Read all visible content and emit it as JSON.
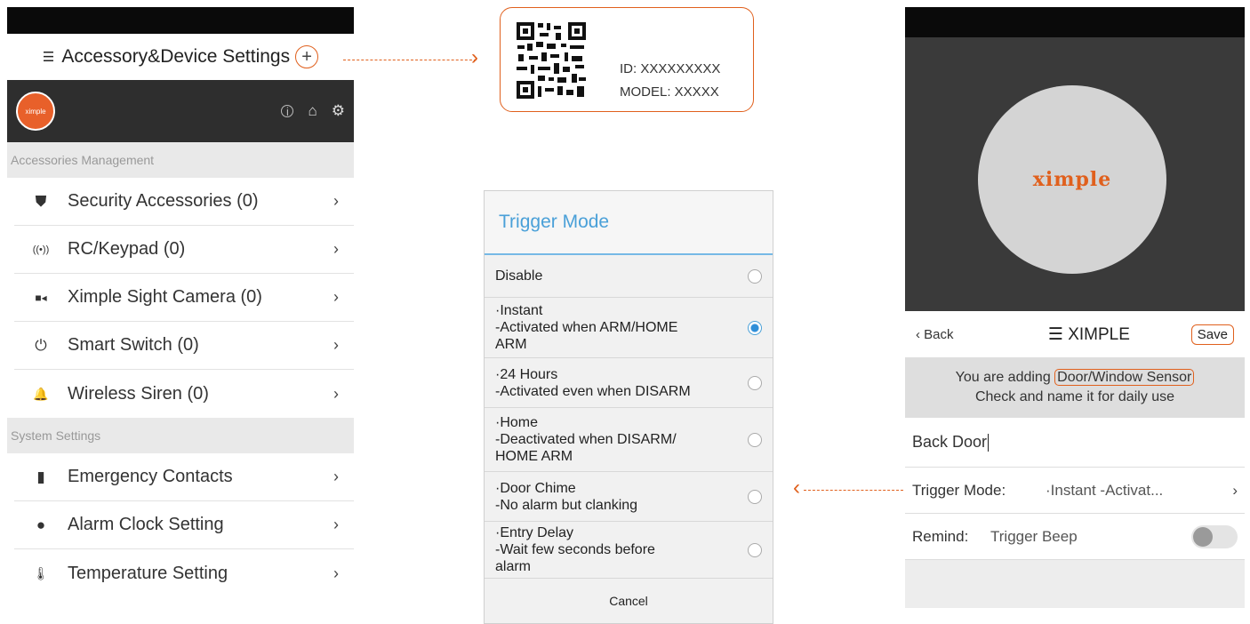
{
  "left": {
    "title": "Accessory&Device Settings",
    "plus": "+",
    "avatar_text": "ximple",
    "sections": [
      {
        "heading": "Accessories Management",
        "items": [
          {
            "label": "Security Accessories (0)",
            "icon": "shield-icon",
            "glyph": "⛊"
          },
          {
            "label": "RC/Keypad (0)",
            "icon": "signal-icon",
            "glyph": "((•))"
          },
          {
            "label": "Ximple Sight Camera (0)",
            "icon": "camera-icon",
            "glyph": "■◂"
          },
          {
            "label": "Smart Switch (0)",
            "icon": "power-icon",
            "glyph": "⏻"
          },
          {
            "label": "Wireless Siren (0)",
            "icon": "siren-icon",
            "glyph": "🔔"
          }
        ]
      },
      {
        "heading": "System Settings",
        "items": [
          {
            "label": "Emergency Contacts",
            "icon": "contacts-icon",
            "glyph": "▮"
          },
          {
            "label": "Alarm Clock Setting",
            "icon": "clock-icon",
            "glyph": "●"
          },
          {
            "label": "Temperature Setting",
            "icon": "thermometer-icon",
            "glyph": "🌡"
          }
        ]
      }
    ],
    "chevron": "›"
  },
  "qr": {
    "id": "ID: XXXXXXXXX",
    "model": "MODEL: XXXXX"
  },
  "dialog": {
    "title": "Trigger Mode",
    "options": [
      {
        "text": "Disable",
        "selected": false
      },
      {
        "text": "·Instant\n-Activated when ARM/HOME\nARM",
        "selected": true
      },
      {
        "text": "·24 Hours\n-Activated even when DISARM",
        "selected": false
      },
      {
        "text": "·Home\n-Deactivated when DISARM/\nHOME ARM",
        "selected": false
      },
      {
        "text": "·Door Chime\n-No alarm but clanking",
        "selected": false
      },
      {
        "text": "·Entry Delay\n-Wait few seconds before\nalarm",
        "selected": false
      }
    ],
    "cancel": "Cancel"
  },
  "right": {
    "logo": "ximple",
    "back": "‹ Back",
    "title": "XIMPLE",
    "save": "Save",
    "intro_prefix": "You are adding ",
    "intro_device": "Door/Window Sensor",
    "intro_line2": "Check and name it for daily use",
    "name_value": "Back Door",
    "trigger_label": "Trigger Mode:",
    "trigger_value": "·Instant -Activat...",
    "remind_label": "Remind:",
    "remind_value": "Trigger Beep",
    "remind_on": false
  },
  "colors": {
    "accent": "#e0601d",
    "dialog_title": "#4aa0d8"
  }
}
